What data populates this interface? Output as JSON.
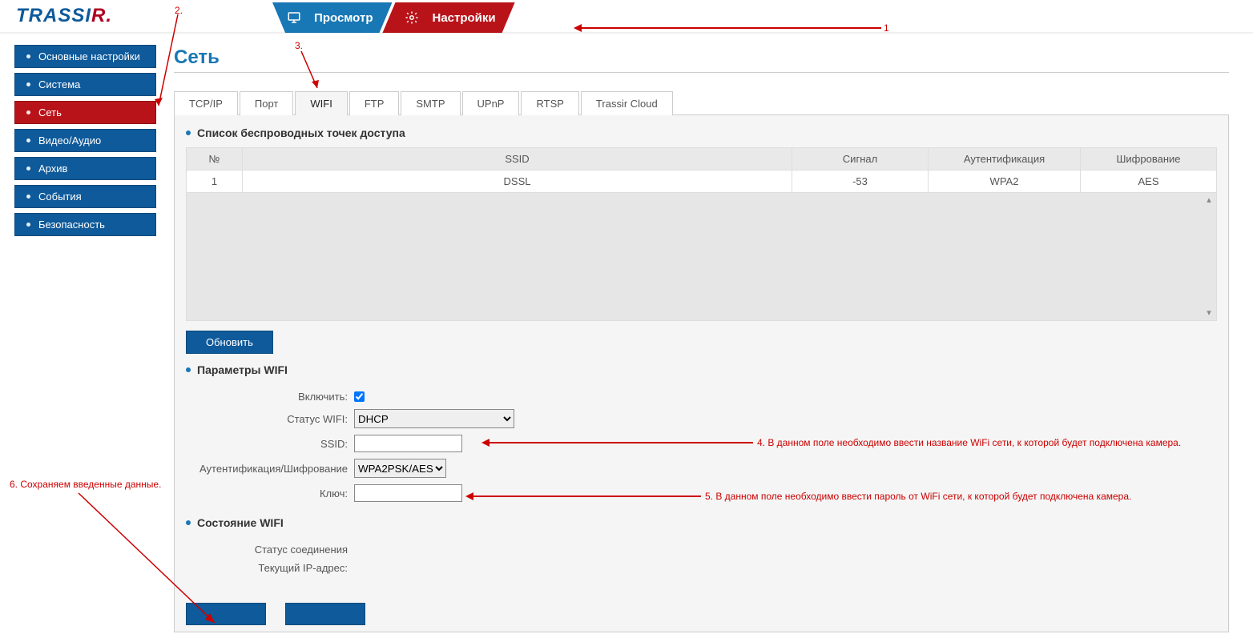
{
  "logo": {
    "part1": "TRASS",
    "part2": "I",
    "part3": "R"
  },
  "topNav": {
    "view": "Просмотр",
    "settings": "Настройки"
  },
  "sidebar": {
    "items": [
      {
        "label": "Основные настройки",
        "active": false
      },
      {
        "label": "Система",
        "active": false
      },
      {
        "label": "Сеть",
        "active": true
      },
      {
        "label": "Видео/Аудио",
        "active": false
      },
      {
        "label": "Архив",
        "active": false
      },
      {
        "label": "События",
        "active": false
      },
      {
        "label": "Безопасность",
        "active": false
      }
    ]
  },
  "pageTitle": "Сеть",
  "subTabs": [
    "TCP/IP",
    "Порт",
    "WIFI",
    "FTP",
    "SMTP",
    "UPnP",
    "RTSP",
    "Trassir Cloud"
  ],
  "activeSubTab": "WIFI",
  "wifiList": {
    "title": "Список беспроводных точек доступа",
    "headers": {
      "no": "№",
      "ssid": "SSID",
      "signal": "Сигнал",
      "auth": "Аутентификация",
      "enc": "Шифрование"
    },
    "rows": [
      {
        "no": "1",
        "ssid": "DSSL",
        "signal": "-53",
        "auth": "WPA2",
        "enc": "AES"
      }
    ],
    "refreshBtn": "Обновить"
  },
  "wifiParams": {
    "title": "Параметры WIFI",
    "enableLabel": "Включить:",
    "enableChecked": true,
    "statusLabel": "Статус WIFI:",
    "statusValue": "DHCP",
    "ssidLabel": "SSID:",
    "ssidValue": "",
    "authEncLabel": "Аутентификация/Шифрование",
    "authEncValue": "WPA2PSK/AES",
    "keyLabel": "Ключ:",
    "keyValue": ""
  },
  "wifiState": {
    "title": "Состояние WIFI",
    "connStatusLabel": "Статус соединения",
    "connStatusValue": "",
    "ipLabel": "Текущий IP-адрес:",
    "ipValue": ""
  },
  "annotations": {
    "a1": "1",
    "a2": "2.",
    "a3": "3.",
    "a4": "4. В данном поле необходимо ввести название WiFi сети, к которой будет подключена камера.",
    "a5": "5. В данном поле необходимо ввести пароль от WiFi сети, к которой будет подключена камера.",
    "a6": "6. Сохраняем введенные данные."
  }
}
